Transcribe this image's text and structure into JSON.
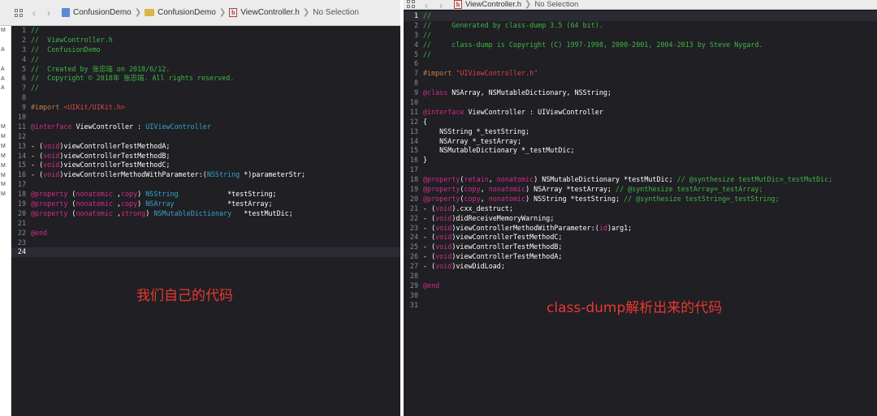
{
  "left": {
    "jumpbar": {
      "project": "ConfusionDemo",
      "group": "ConfusionDemo",
      "file": "ViewController.h",
      "selection": "No Selection"
    },
    "gutter_marks": [
      "M",
      "A",
      "A",
      "A",
      "A",
      "M",
      "M",
      "M",
      "M",
      "M",
      "M",
      "M",
      "M"
    ],
    "current_line": 24,
    "lines": [
      [
        {
          "t": "//",
          "c": "comment"
        }
      ],
      [
        {
          "t": "//  ViewController.h",
          "c": "comment"
        }
      ],
      [
        {
          "t": "//  ConfusionDemo",
          "c": "comment"
        }
      ],
      [
        {
          "t": "//",
          "c": "comment"
        }
      ],
      [
        {
          "t": "//  Created by 张忠瑞 on 2018/6/12.",
          "c": "comment"
        }
      ],
      [
        {
          "t": "//  Copyright © 2018年 张忠瑞. All rights reserved.",
          "c": "comment"
        }
      ],
      [
        {
          "t": "//",
          "c": "comment"
        }
      ],
      [],
      [
        {
          "t": "#import ",
          "c": "pre"
        },
        {
          "t": "<UIKit/UIKit.h>",
          "c": "str"
        }
      ],
      [],
      [
        {
          "t": "@interface",
          "c": "kw"
        },
        {
          "t": " ViewController : ",
          "c": "plain"
        },
        {
          "t": "UIViewController",
          "c": "type"
        }
      ],
      [],
      [
        {
          "t": "- (",
          "c": "plain"
        },
        {
          "t": "void",
          "c": "kw"
        },
        {
          "t": ")viewControllerTestMethodA;",
          "c": "plain"
        }
      ],
      [
        {
          "t": "- (",
          "c": "plain"
        },
        {
          "t": "void",
          "c": "kw"
        },
        {
          "t": ")viewControllerTestMethodB;",
          "c": "plain"
        }
      ],
      [
        {
          "t": "- (",
          "c": "plain"
        },
        {
          "t": "void",
          "c": "kw"
        },
        {
          "t": ")viewControllerTestMethodC;",
          "c": "plain"
        }
      ],
      [
        {
          "t": "- (",
          "c": "plain"
        },
        {
          "t": "void",
          "c": "kw"
        },
        {
          "t": ")viewControllerMethodWithParameter:(",
          "c": "plain"
        },
        {
          "t": "NSString",
          "c": "type"
        },
        {
          "t": " *)parameterStr;",
          "c": "plain"
        }
      ],
      [],
      [
        {
          "t": "@property",
          "c": "kw"
        },
        {
          "t": " (",
          "c": "plain"
        },
        {
          "t": "nonatomic",
          "c": "kw"
        },
        {
          "t": " ,",
          "c": "plain"
        },
        {
          "t": "copy",
          "c": "kw"
        },
        {
          "t": ") ",
          "c": "plain"
        },
        {
          "t": "NSString",
          "c": "type"
        },
        {
          "t": "            *testString;",
          "c": "plain"
        }
      ],
      [
        {
          "t": "@property",
          "c": "kw"
        },
        {
          "t": " (",
          "c": "plain"
        },
        {
          "t": "nonatomic",
          "c": "kw"
        },
        {
          "t": " ,",
          "c": "plain"
        },
        {
          "t": "copy",
          "c": "kw"
        },
        {
          "t": ") ",
          "c": "plain"
        },
        {
          "t": "NSArray",
          "c": "type"
        },
        {
          "t": "             *testArray;",
          "c": "plain"
        }
      ],
      [
        {
          "t": "@property",
          "c": "kw"
        },
        {
          "t": " (",
          "c": "plain"
        },
        {
          "t": "nonatomic",
          "c": "kw"
        },
        {
          "t": " ,",
          "c": "plain"
        },
        {
          "t": "strong",
          "c": "kw"
        },
        {
          "t": ") ",
          "c": "plain"
        },
        {
          "t": "NSMutableDictionary",
          "c": "type"
        },
        {
          "t": "   *testMutDic;",
          "c": "plain"
        }
      ],
      [],
      [
        {
          "t": "@end",
          "c": "kw"
        }
      ],
      [],
      []
    ],
    "caption": "我们自己的代码"
  },
  "right": {
    "jumpbar": {
      "file": "ViewController.h",
      "selection": "No Selection"
    },
    "current_line": 1,
    "lines": [
      [
        {
          "t": "//",
          "c": "comment"
        }
      ],
      [
        {
          "t": "//     Generated by class-dump 3.5 (64 bit).",
          "c": "comment"
        }
      ],
      [
        {
          "t": "//",
          "c": "comment"
        }
      ],
      [
        {
          "t": "//     class-dump is Copyright (C) 1997-1998, 2000-2001, 2004-2013 by Steve Nygard.",
          "c": "comment"
        }
      ],
      [
        {
          "t": "//",
          "c": "comment"
        }
      ],
      [],
      [
        {
          "t": "#import ",
          "c": "pre"
        },
        {
          "t": "\"UIViewController.h\"",
          "c": "str"
        }
      ],
      [],
      [
        {
          "t": "@class",
          "c": "kw"
        },
        {
          "t": " NSArray, NSMutableDictionary, NSString;",
          "c": "plain"
        }
      ],
      [],
      [
        {
          "t": "@interface",
          "c": "kw"
        },
        {
          "t": " ViewController : UIViewController",
          "c": "plain"
        }
      ],
      [
        {
          "t": "{",
          "c": "plain"
        }
      ],
      [
        {
          "t": "    NSString *_testString;",
          "c": "plain"
        }
      ],
      [
        {
          "t": "    NSArray *_testArray;",
          "c": "plain"
        }
      ],
      [
        {
          "t": "    NSMutableDictionary *_testMutDic;",
          "c": "plain"
        }
      ],
      [
        {
          "t": "}",
          "c": "plain"
        }
      ],
      [],
      [
        {
          "t": "@property",
          "c": "kw"
        },
        {
          "t": "(",
          "c": "plain"
        },
        {
          "t": "retain",
          "c": "kw"
        },
        {
          "t": ", ",
          "c": "plain"
        },
        {
          "t": "nonatomic",
          "c": "kw"
        },
        {
          "t": ") NSMutableDictionary *testMutDic; ",
          "c": "plain"
        },
        {
          "t": "// @synthesize testMutDic=_testMutDic;",
          "c": "comment"
        }
      ],
      [
        {
          "t": "@property",
          "c": "kw"
        },
        {
          "t": "(",
          "c": "plain"
        },
        {
          "t": "copy",
          "c": "kw"
        },
        {
          "t": ", ",
          "c": "plain"
        },
        {
          "t": "nonatomic",
          "c": "kw"
        },
        {
          "t": ") NSArray *testArray; ",
          "c": "plain"
        },
        {
          "t": "// @synthesize testArray=_testArray;",
          "c": "comment"
        }
      ],
      [
        {
          "t": "@property",
          "c": "kw"
        },
        {
          "t": "(",
          "c": "plain"
        },
        {
          "t": "copy",
          "c": "kw"
        },
        {
          "t": ", ",
          "c": "plain"
        },
        {
          "t": "nonatomic",
          "c": "kw"
        },
        {
          "t": ") NSString *testString; ",
          "c": "plain"
        },
        {
          "t": "// @synthesize testString=_testString;",
          "c": "comment"
        }
      ],
      [
        {
          "t": "- (",
          "c": "plain"
        },
        {
          "t": "void",
          "c": "kw"
        },
        {
          "t": ").cxx_destruct;",
          "c": "plain"
        }
      ],
      [
        {
          "t": "- (",
          "c": "plain"
        },
        {
          "t": "void",
          "c": "kw"
        },
        {
          "t": ")didReceiveMemoryWarning;",
          "c": "plain"
        }
      ],
      [
        {
          "t": "- (",
          "c": "plain"
        },
        {
          "t": "void",
          "c": "kw"
        },
        {
          "t": ")viewControllerMethodWithParameter:(",
          "c": "plain"
        },
        {
          "t": "id",
          "c": "kw"
        },
        {
          "t": ")arg1;",
          "c": "plain"
        }
      ],
      [
        {
          "t": "- (",
          "c": "plain"
        },
        {
          "t": "void",
          "c": "kw"
        },
        {
          "t": ")viewControllerTestMethodC;",
          "c": "plain"
        }
      ],
      [
        {
          "t": "- (",
          "c": "plain"
        },
        {
          "t": "void",
          "c": "kw"
        },
        {
          "t": ")viewControllerTestMethodB;",
          "c": "plain"
        }
      ],
      [
        {
          "t": "- (",
          "c": "plain"
        },
        {
          "t": "void",
          "c": "kw"
        },
        {
          "t": ")viewControllerTestMethodA;",
          "c": "plain"
        }
      ],
      [
        {
          "t": "- (",
          "c": "plain"
        },
        {
          "t": "void",
          "c": "kw"
        },
        {
          "t": ")viewDidLoad;",
          "c": "plain"
        }
      ],
      [],
      [
        {
          "t": "@end",
          "c": "kw"
        }
      ],
      [],
      []
    ],
    "caption": "class-dump解析出来的代码"
  },
  "colors": {
    "background": "#1f1f24",
    "comment": "#41b645",
    "keyword": "#d42b88",
    "preprocessor": "#c57c44",
    "string": "#e0433f",
    "type": "#35a6c9",
    "caption": "#e8392f"
  },
  "icons": [
    "grid-icon",
    "chevron-left-icon",
    "chevron-right-icon",
    "project-file-icon",
    "folder-icon",
    "header-file-icon"
  ]
}
